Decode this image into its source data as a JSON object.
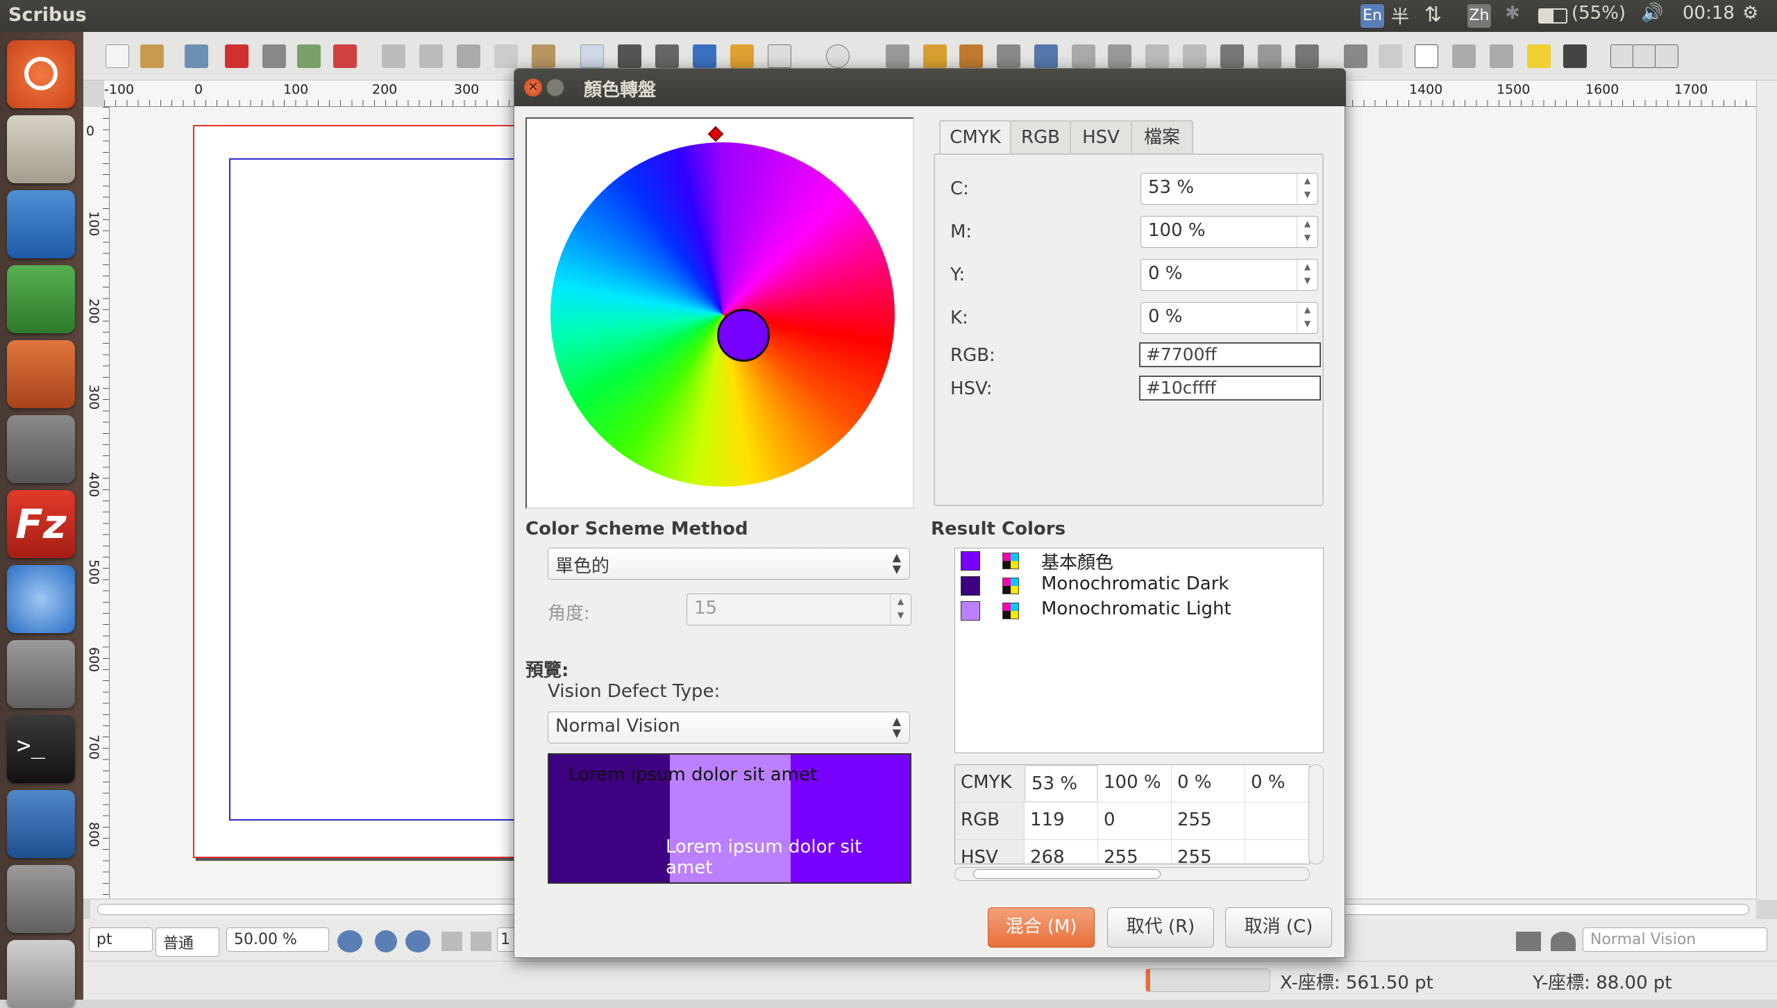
{
  "topbar": {
    "app_title": "Scribus",
    "indicators": [
      "En",
      "半",
      "Zh"
    ],
    "battery": "(55%)",
    "time": "00:18"
  },
  "rulers": {
    "h_labels": [
      "-100",
      "0",
      "100",
      "200",
      "300",
      "1400",
      "1500",
      "1600",
      "1700"
    ],
    "v_labels": [
      "0",
      "100",
      "200",
      "300",
      "400",
      "500",
      "600",
      "700",
      "800"
    ]
  },
  "bottom": {
    "unit": "pt",
    "mode": "普通",
    "zoom": "50.00 %",
    "page_field": "1",
    "vision": "Normal Vision",
    "x_coord": "X-座標: 561.50 pt",
    "y_coord": "Y-座標: 88.00 pt"
  },
  "dialog": {
    "title": "顏色轉盤",
    "tabs": [
      "CMYK",
      "RGB",
      "HSV",
      "檔案"
    ],
    "fields": {
      "c_label": "C:",
      "c_value": "53 %",
      "m_label": "M:",
      "m_value": "100 %",
      "y_label": "Y:",
      "y_value": "0 %",
      "k_label": "K:",
      "k_value": "0 %",
      "rgb_label": "RGB:",
      "rgb_value": "#7700ff",
      "hsv_label": "HSV:",
      "hsv_value": "#10cffff"
    },
    "scheme_label": "Color Scheme Method",
    "scheme_value": "單色的",
    "angle_label": "角度:",
    "angle_value": "15",
    "preview_label": "預覽:",
    "vision_label": "Vision Defect Type:",
    "vision_value": "Normal Vision",
    "preview_text_1": "Lorem ipsum dolor sit amet",
    "preview_text_2": "Lorem ipsum dolor sit amet",
    "result_label": "Result Colors",
    "results": [
      {
        "name": "基本顏色",
        "color": "#7700ff"
      },
      {
        "name": "Monochromatic Dark",
        "color": "#3d0080"
      },
      {
        "name": "Monochromatic Light",
        "color": "#bb80ff"
      }
    ],
    "table": {
      "rows": [
        [
          "CMYK",
          "53 %",
          "100 %",
          "0 %",
          "0 %"
        ],
        [
          "RGB",
          "119",
          "0",
          "255",
          ""
        ],
        [
          "HSV",
          "268",
          "255",
          "255",
          ""
        ]
      ]
    },
    "buttons": {
      "mix": "混合 (M)",
      "replace": "取代 (R)",
      "cancel": "取消 (C)"
    },
    "current_color": "#7700ff"
  }
}
